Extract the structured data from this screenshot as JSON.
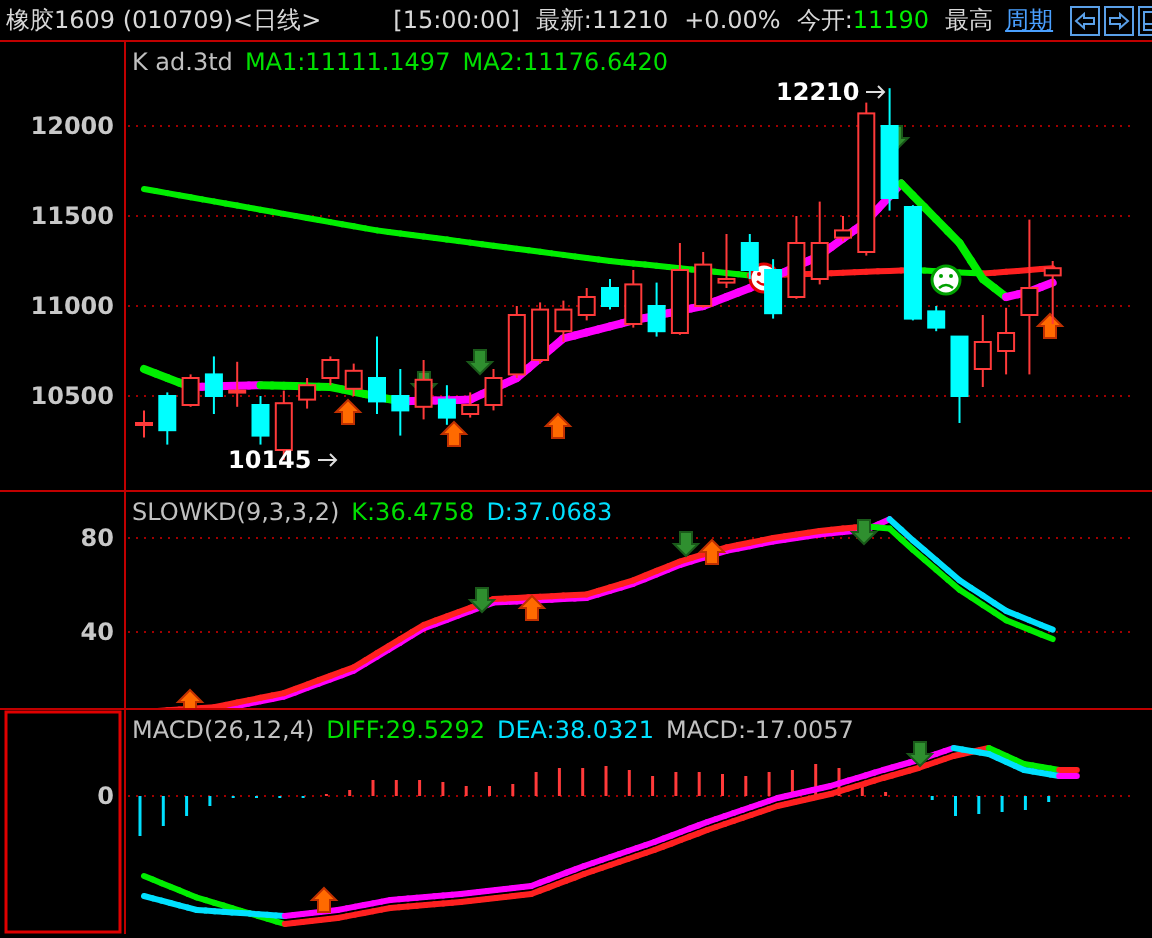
{
  "header": {
    "title": "橡胶1609 (010709)<日线>",
    "time": "[15:00:00]",
    "last": "最新:11210",
    "change": "+0.00%",
    "open_label": "今开:",
    "open_value": "11190",
    "high_label": "最高",
    "period_link": "周期"
  },
  "panels": [
    {
      "kind": "price",
      "selected": false,
      "legend": [
        {
          "text": "K  ad.3td",
          "color": "#c0c0c0"
        },
        {
          "text": "MA1:11111.1497",
          "color": "#00e000"
        },
        {
          "text": "MA2:11176.6420",
          "color": "#00e000"
        }
      ],
      "yticks": [
        "12000",
        "11500",
        "11000",
        "10500"
      ],
      "annotations": [
        "12210",
        "10145"
      ],
      "chart_data": {
        "type": "candlestick",
        "ohlc": [
          [
            10350,
            10420,
            10270,
            10350
          ],
          [
            10500,
            10520,
            10230,
            10310
          ],
          [
            10450,
            10620,
            10440,
            10600
          ],
          [
            10620,
            10720,
            10400,
            10500
          ],
          [
            10520,
            10690,
            10440,
            10530
          ],
          [
            10450,
            10500,
            10230,
            10280
          ],
          [
            10200,
            10530,
            10145,
            10460
          ],
          [
            10480,
            10600,
            10430,
            10560
          ],
          [
            10600,
            10720,
            10560,
            10700
          ],
          [
            10540,
            10680,
            10500,
            10640
          ],
          [
            10600,
            10830,
            10400,
            10470
          ],
          [
            10500,
            10650,
            10280,
            10420
          ],
          [
            10440,
            10700,
            10370,
            10590
          ],
          [
            10480,
            10560,
            10340,
            10380
          ],
          [
            10400,
            10520,
            10380,
            10450
          ],
          [
            10450,
            10650,
            10420,
            10600
          ],
          [
            10620,
            11000,
            10600,
            10950
          ],
          [
            10700,
            11020,
            10680,
            10980
          ],
          [
            10860,
            11030,
            10800,
            10980
          ],
          [
            10950,
            11100,
            10920,
            11050
          ],
          [
            11100,
            11150,
            10980,
            11000
          ],
          [
            10900,
            11200,
            10880,
            11120
          ],
          [
            11000,
            11130,
            10830,
            10860
          ],
          [
            10850,
            11350,
            10840,
            11200
          ],
          [
            11000,
            11300,
            10990,
            11230
          ],
          [
            11130,
            11400,
            11100,
            11150
          ],
          [
            11350,
            11400,
            11150,
            11200
          ],
          [
            11200,
            11260,
            10930,
            10960
          ],
          [
            11050,
            11500,
            11040,
            11350
          ],
          [
            11150,
            11580,
            11120,
            11350
          ],
          [
            11380,
            11500,
            11360,
            11420
          ],
          [
            11300,
            12130,
            11280,
            12070
          ],
          [
            12000,
            12210,
            11530,
            11600
          ],
          [
            11550,
            11560,
            10920,
            10930
          ],
          [
            10970,
            11000,
            10860,
            10880
          ],
          [
            10830,
            10830,
            10350,
            10500
          ],
          [
            10650,
            10950,
            10550,
            10800
          ],
          [
            10750,
            10990,
            10620,
            10850
          ],
          [
            10950,
            11480,
            10620,
            11100
          ],
          [
            11170,
            11250,
            10900,
            11210
          ]
        ]
      }
    },
    {
      "kind": "kd",
      "selected": false,
      "legend": [
        {
          "text": "SLOWKD(9,3,3,2)",
          "color": "#c0c0c0"
        },
        {
          "text": "K:36.4758",
          "color": "#00e000"
        },
        {
          "text": "D:37.0683",
          "color": "#00e0ff"
        }
      ],
      "yticks": [
        "80",
        "40"
      ]
    },
    {
      "kind": "macd",
      "selected": true,
      "legend": [
        {
          "text": "MACD(26,12,4)",
          "color": "#c0c0c0"
        },
        {
          "text": "DIFF:29.5292",
          "color": "#00e000"
        },
        {
          "text": "DEA:38.0321",
          "color": "#00e0ff"
        },
        {
          "text": "MACD:-17.0057",
          "color": "#c0c0c0"
        }
      ],
      "yticks": [
        "0"
      ]
    }
  ]
}
